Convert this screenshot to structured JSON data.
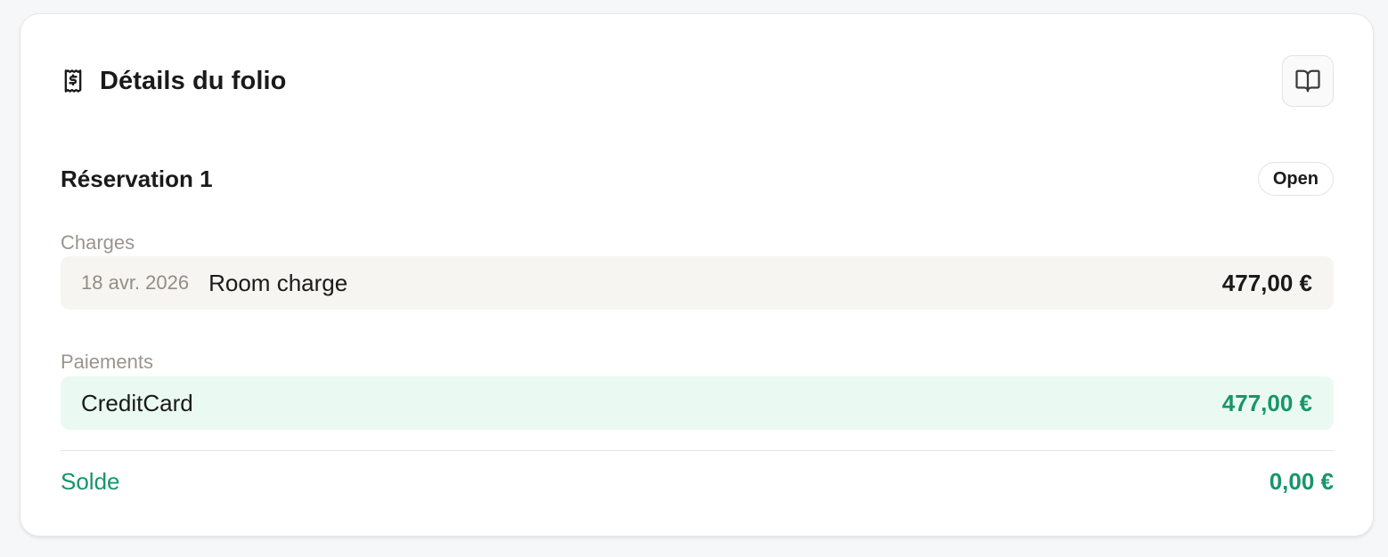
{
  "folio": {
    "title": "Détails du folio",
    "title_icon": "receipt-icon",
    "action_icon": "book-open-icon"
  },
  "reservation": {
    "title": "Réservation 1",
    "status": "Open"
  },
  "charges": {
    "label": "Charges",
    "items": [
      {
        "date": "18 avr. 2026",
        "description": "Room charge",
        "amount": "477,00 €"
      }
    ]
  },
  "payments": {
    "label": "Paiements",
    "items": [
      {
        "description": "CreditCard",
        "amount": "477,00 €"
      }
    ]
  },
  "balance": {
    "label": "Solde",
    "amount": "0,00 €"
  },
  "colors": {
    "accent_green": "#16966a",
    "charge_row_bg": "#f6f5f1",
    "payment_row_bg": "#eafaf2",
    "muted_text": "#9a958c"
  }
}
